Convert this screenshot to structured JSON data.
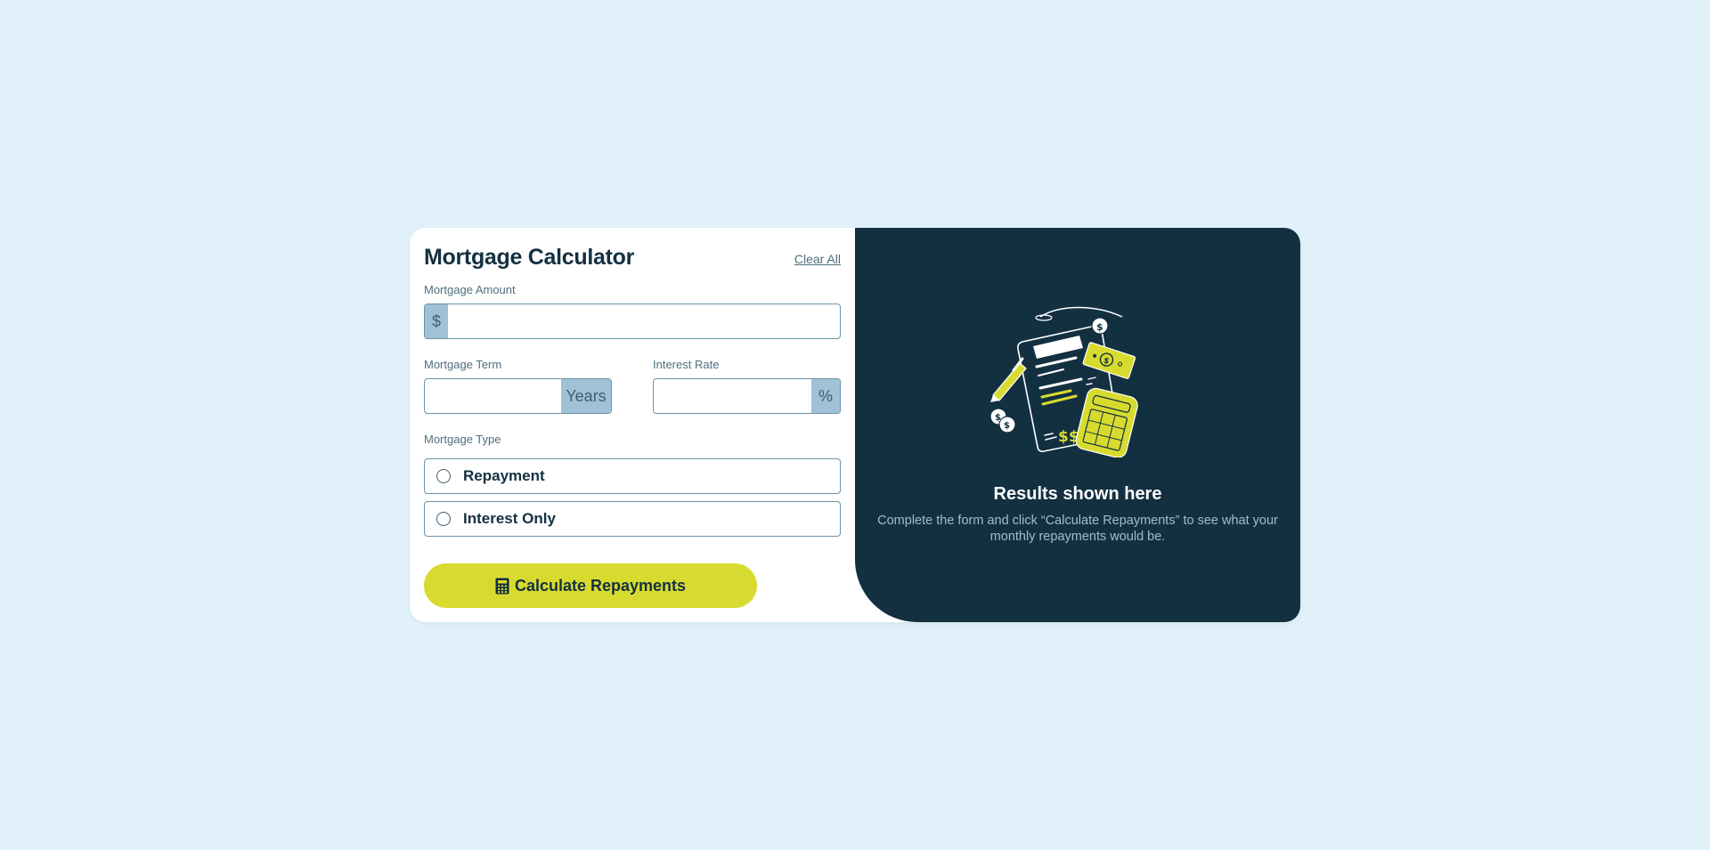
{
  "form": {
    "title": "Mortgage Calculator",
    "clear_all": "Clear All",
    "amount": {
      "label": "Mortgage Amount",
      "prefix": "$",
      "value": ""
    },
    "term": {
      "label": "Mortgage Term",
      "suffix": "Years",
      "value": ""
    },
    "rate": {
      "label": "Interest Rate",
      "suffix": "%",
      "value": ""
    },
    "type": {
      "label": "Mortgage Type",
      "options": [
        "Repayment",
        "Interest Only"
      ]
    },
    "button_label": "Calculate Repayments",
    "button_icon": "calculator-icon"
  },
  "results": {
    "title": "Results shown here",
    "text": "Complete the form and click “Calculate Repayments” to see what your monthly repayments would be.",
    "illustration": "empty-results-illustration",
    "dollar_signs": "$$$"
  },
  "colors": {
    "page_bg": "#e0f1f9",
    "dark_panel": "#133041",
    "accent_lime": "#d8db2f",
    "addon_bg": "#9fc2d6",
    "muted_text": "#4e6e7e"
  }
}
